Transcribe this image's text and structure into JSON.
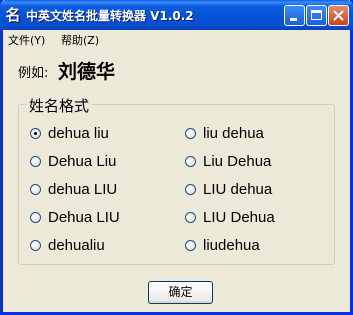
{
  "window": {
    "icon_glyph": "名",
    "title": "中英文姓名批量转换器 V1.0.2"
  },
  "menu": {
    "file": "文件(Y)",
    "help": "帮助(Z)"
  },
  "example": {
    "label": "例如:",
    "name": "刘德华"
  },
  "group": {
    "title": "姓名格式",
    "options": [
      {
        "label": "dehua liu",
        "checked": true
      },
      {
        "label": "liu dehua",
        "checked": false
      },
      {
        "label": "Dehua Liu",
        "checked": false
      },
      {
        "label": "Liu Dehua",
        "checked": false
      },
      {
        "label": "dehua LIU",
        "checked": false
      },
      {
        "label": "LIU dehua",
        "checked": false
      },
      {
        "label": "Dehua LIU",
        "checked": false
      },
      {
        "label": "LIU Dehua",
        "checked": false
      },
      {
        "label": "dehualiu",
        "checked": false
      },
      {
        "label": "liudehua",
        "checked": false
      }
    ]
  },
  "ok_button": "确定",
  "colors": {
    "titlebar": "#0453d8",
    "face": "#ece9d8",
    "close_button": "#c7441f"
  }
}
